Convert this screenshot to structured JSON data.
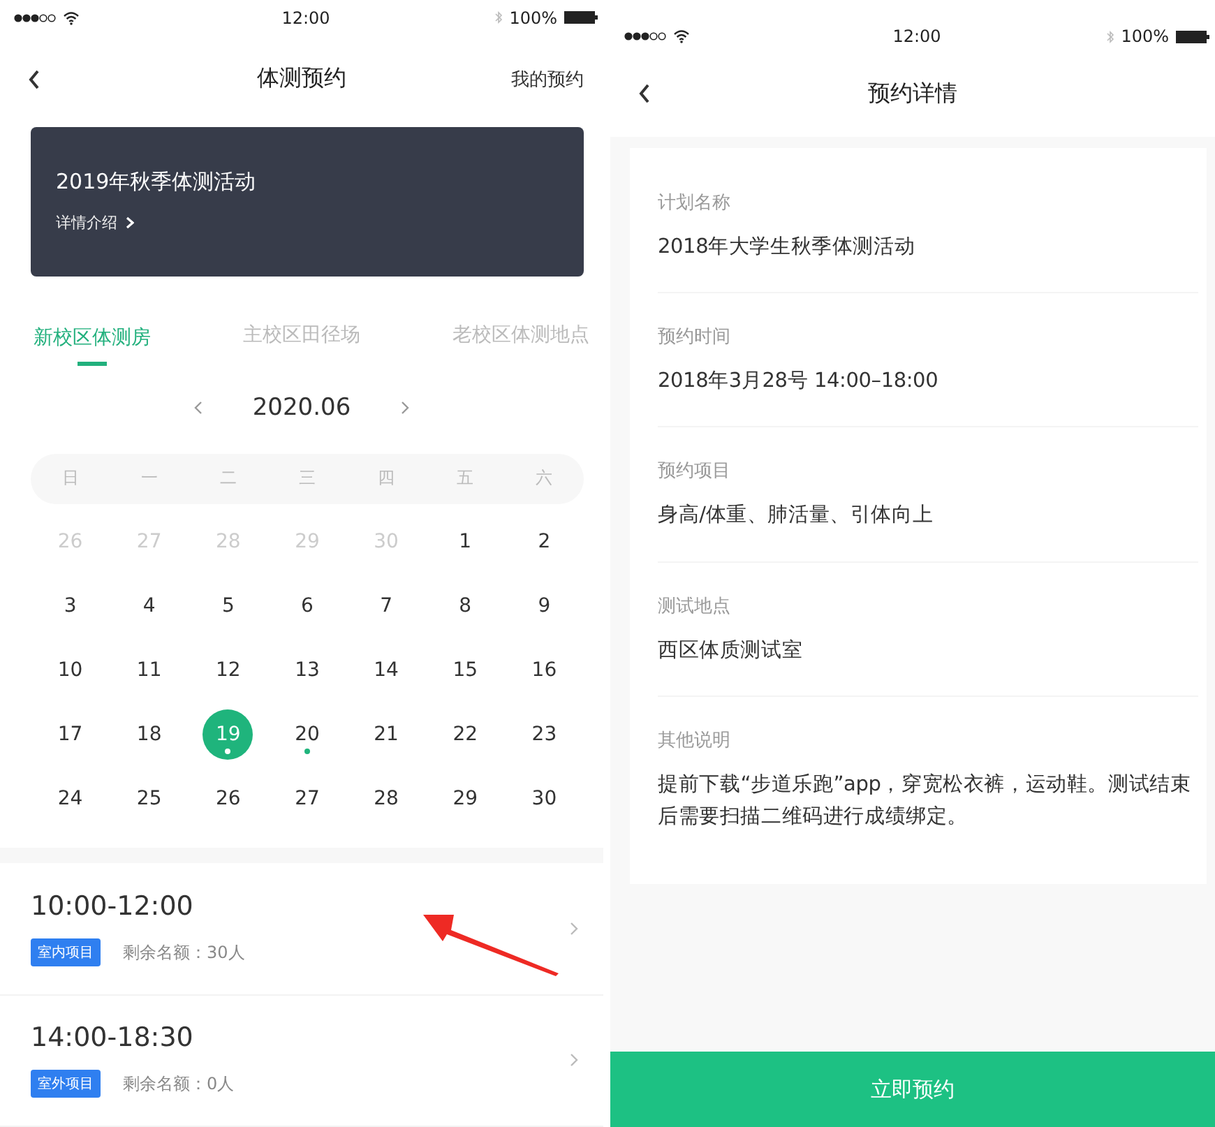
{
  "booking_screen": {
    "status_bar": {
      "time": "12:00",
      "battery": "100%"
    },
    "nav": {
      "title": "体测预约",
      "action": "我的预约"
    },
    "banner": {
      "title": "2019年秋季体测活动",
      "link": "详情介绍"
    },
    "tabs": [
      {
        "label": "新校区体测房",
        "selected": true
      },
      {
        "label": "主校区田径场",
        "selected": false
      },
      {
        "label": "老校区体测地点",
        "selected": false
      }
    ],
    "calendar": {
      "month": "2020.06",
      "weekdays": [
        "日",
        "一",
        "二",
        "三",
        "四",
        "五",
        "六"
      ],
      "days": [
        {
          "label": "26",
          "muted": true,
          "selected": false,
          "marked": false
        },
        {
          "label": "27",
          "muted": true,
          "selected": false,
          "marked": false
        },
        {
          "label": "28",
          "muted": true,
          "selected": false,
          "marked": false
        },
        {
          "label": "29",
          "muted": true,
          "selected": false,
          "marked": false
        },
        {
          "label": "30",
          "muted": true,
          "selected": false,
          "marked": false
        },
        {
          "label": "1",
          "muted": false,
          "selected": false,
          "marked": false
        },
        {
          "label": "2",
          "muted": false,
          "selected": false,
          "marked": false
        },
        {
          "label": "3",
          "muted": false,
          "selected": false,
          "marked": false
        },
        {
          "label": "4",
          "muted": false,
          "selected": false,
          "marked": false
        },
        {
          "label": "5",
          "muted": false,
          "selected": false,
          "marked": false
        },
        {
          "label": "6",
          "muted": false,
          "selected": false,
          "marked": false
        },
        {
          "label": "7",
          "muted": false,
          "selected": false,
          "marked": false
        },
        {
          "label": "8",
          "muted": false,
          "selected": false,
          "marked": false
        },
        {
          "label": "9",
          "muted": false,
          "selected": false,
          "marked": false
        },
        {
          "label": "10",
          "muted": false,
          "selected": false,
          "marked": false
        },
        {
          "label": "11",
          "muted": false,
          "selected": false,
          "marked": false
        },
        {
          "label": "12",
          "muted": false,
          "selected": false,
          "marked": false
        },
        {
          "label": "13",
          "muted": false,
          "selected": false,
          "marked": false
        },
        {
          "label": "14",
          "muted": false,
          "selected": false,
          "marked": false
        },
        {
          "label": "15",
          "muted": false,
          "selected": false,
          "marked": false
        },
        {
          "label": "16",
          "muted": false,
          "selected": false,
          "marked": false
        },
        {
          "label": "17",
          "muted": false,
          "selected": false,
          "marked": false
        },
        {
          "label": "18",
          "muted": false,
          "selected": false,
          "marked": false
        },
        {
          "label": "19",
          "muted": false,
          "selected": true,
          "marked": true
        },
        {
          "label": "20",
          "muted": false,
          "selected": false,
          "marked": true
        },
        {
          "label": "21",
          "muted": false,
          "selected": false,
          "marked": false
        },
        {
          "label": "22",
          "muted": false,
          "selected": false,
          "marked": false
        },
        {
          "label": "23",
          "muted": false,
          "selected": false,
          "marked": false
        },
        {
          "label": "24",
          "muted": false,
          "selected": false,
          "marked": false
        },
        {
          "label": "25",
          "muted": false,
          "selected": false,
          "marked": false
        },
        {
          "label": "26",
          "muted": false,
          "selected": false,
          "marked": false
        },
        {
          "label": "27",
          "muted": false,
          "selected": false,
          "marked": false
        },
        {
          "label": "28",
          "muted": false,
          "selected": false,
          "marked": false
        },
        {
          "label": "29",
          "muted": false,
          "selected": false,
          "marked": false
        },
        {
          "label": "30",
          "muted": false,
          "selected": false,
          "marked": false
        }
      ]
    },
    "slots": [
      {
        "time": "10:00-12:00",
        "tag": "室内项目",
        "remaining": "剩余名额：30人"
      },
      {
        "time": "14:00-18:30",
        "tag": "室外项目",
        "remaining": "剩余名额：0人"
      }
    ]
  },
  "detail_screen": {
    "status_bar": {
      "time": "12:00",
      "battery": "100%"
    },
    "nav": {
      "title": "预约详情"
    },
    "fields": [
      {
        "label": "计划名称",
        "value": "2018年大学生秋季体测活动"
      },
      {
        "label": "预约时间",
        "value": "2018年3月28号 14:00–18:00"
      },
      {
        "label": "预约项目",
        "value": "身高/体重、肺活量、引体向上"
      },
      {
        "label": "测试地点",
        "value": "西区体质测试室"
      },
      {
        "label": "其他说明",
        "value": "提前下载“步道乐跑”app，穿宽松衣裤，运动鞋。测试结束后需要扫描二维码进行成绩绑定。"
      }
    ],
    "button": "立即预约"
  }
}
